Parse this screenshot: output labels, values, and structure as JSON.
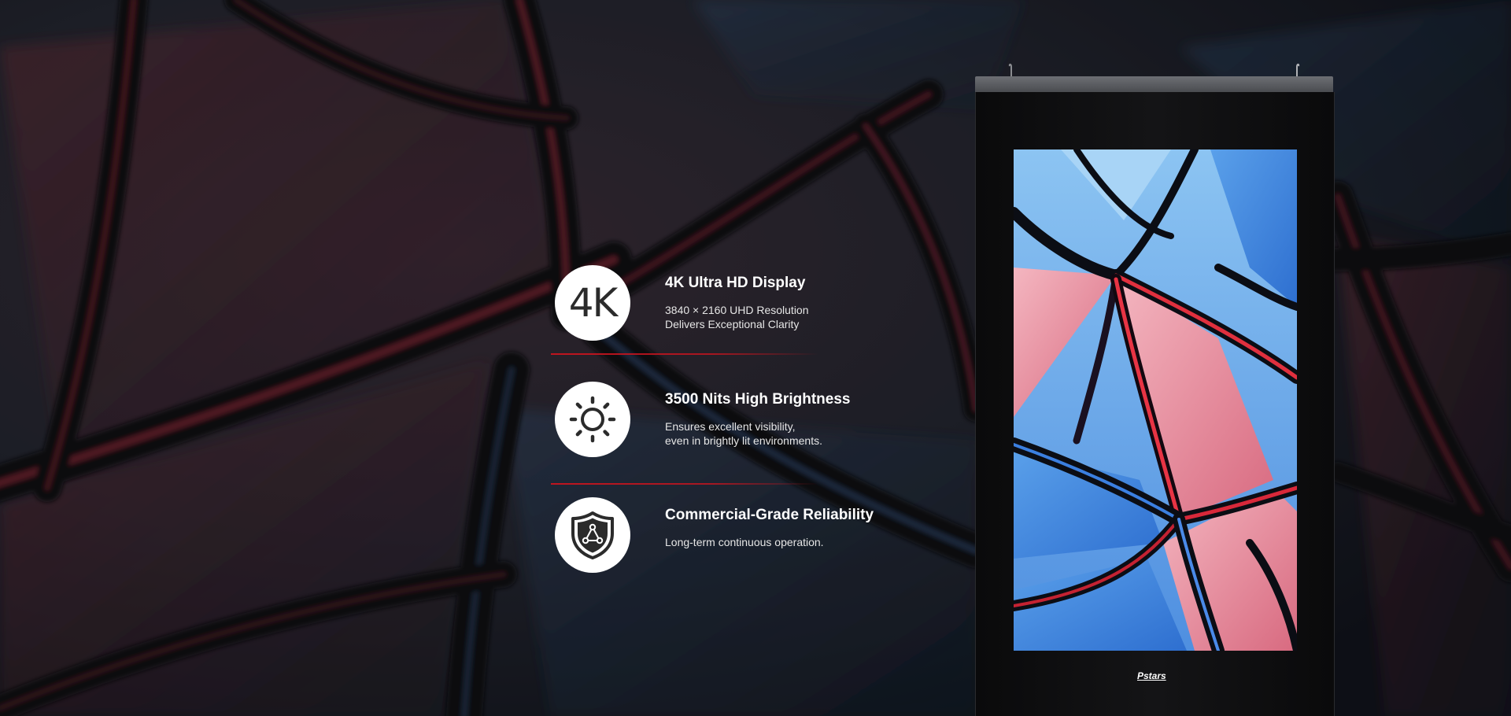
{
  "features": [
    {
      "icon": "4k-icon",
      "icon_text": "4K",
      "title": "4K Ultra HD Display",
      "desc_line1": "3840 × 2160 UHD Resolution",
      "desc_line2": "Delivers Exceptional Clarity"
    },
    {
      "icon": "sun-brightness-icon",
      "title": "3500 Nits High Brightness",
      "desc_line1": "Ensures excellent visibility,",
      "desc_line2": "even in brightly lit environments."
    },
    {
      "icon": "shield-network-icon",
      "title": "Commercial-Grade Reliability",
      "desc_line1": "Long-term continuous operation."
    }
  ],
  "kiosk": {
    "brand": "Pstars"
  },
  "colors": {
    "accent_red": "#c8141e",
    "icon_dark": "#2b2b2b",
    "text_white": "#ffffff"
  }
}
